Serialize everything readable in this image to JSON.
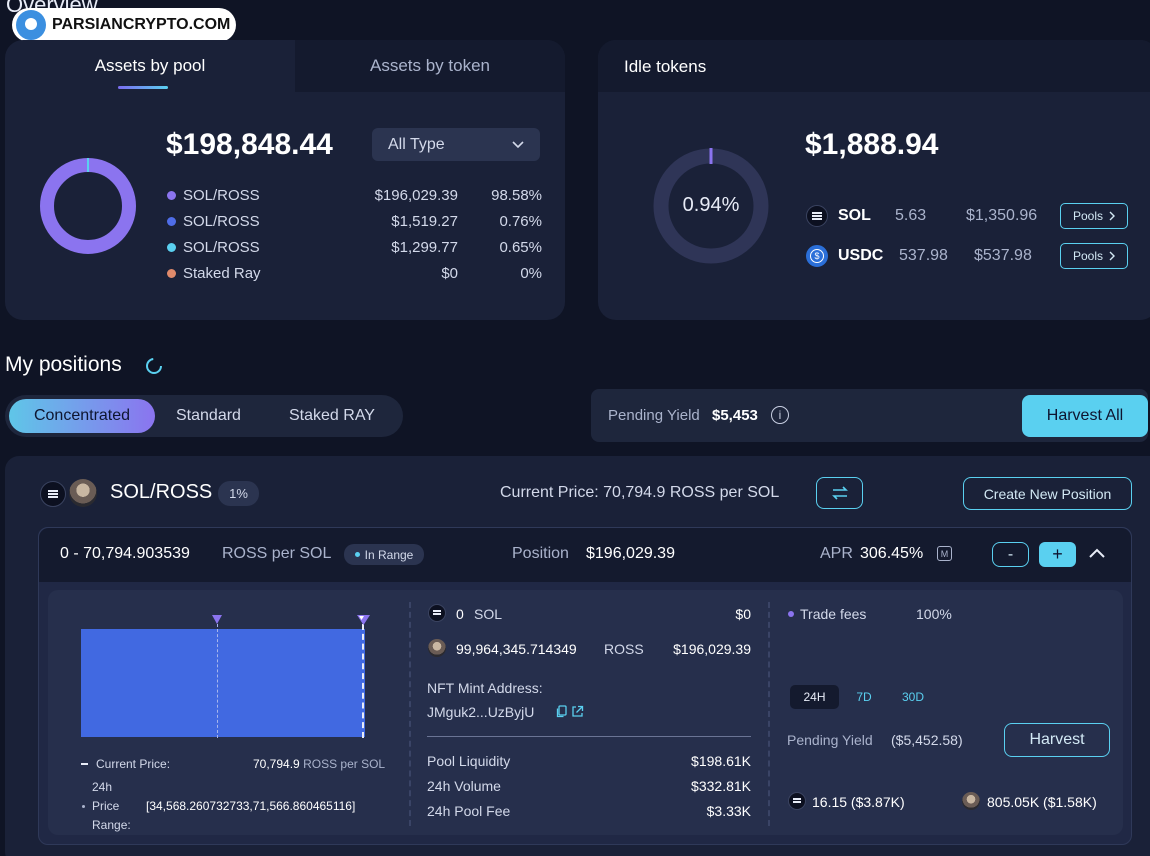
{
  "watermark": "PARSIANCRYPTO.COM",
  "overview_title": "Overview",
  "assets": {
    "tabs": [
      {
        "label": "Assets by pool"
      },
      {
        "label": "Assets by token"
      }
    ],
    "total": "$198,848.44",
    "filter": "All Type",
    "rows": [
      {
        "name": "SOL/ROSS",
        "value": "$196,029.39",
        "pct": "98.58%",
        "color": "#8b74ef"
      },
      {
        "name": "SOL/ROSS",
        "value": "$1,519.27",
        "pct": "0.76%",
        "color": "#4f6de8"
      },
      {
        "name": "SOL/ROSS",
        "value": "$1,299.77",
        "pct": "0.65%",
        "color": "#5ad0f0"
      },
      {
        "name": "Staked Ray",
        "value": "$0",
        "pct": "0%",
        "color": "#e08a6b"
      }
    ]
  },
  "idle": {
    "title": "Idle tokens",
    "total": "$1,888.94",
    "pct": "0.94%",
    "tokens": [
      {
        "symbol": "SOL",
        "amount": "5.63",
        "value": "$1,350.96",
        "btn": "Pools"
      },
      {
        "symbol": "USDC",
        "amount": "537.98",
        "value": "$537.98",
        "btn": "Pools"
      }
    ]
  },
  "positions": {
    "title": "My positions",
    "tabs": [
      "Concentrated",
      "Standard",
      "Staked RAY"
    ],
    "pending_label": "Pending Yield",
    "pending_value": "$5,453",
    "harvest_all": "Harvest All"
  },
  "pool": {
    "pair": "SOL/ROSS",
    "fee": "1%",
    "current_price": "Current Price: 70,794.9 ROSS per SOL",
    "create": "Create New Position",
    "range": "0 - 70,794.903539",
    "range_unit": "ROSS per SOL",
    "in_range": "In Range",
    "position_label": "Position",
    "position_value": "$196,029.39",
    "apr_label": "APR",
    "apr_value": "306.45%",
    "apr_badge": "M",
    "minus": "-",
    "plus": "+",
    "chart": {
      "current_price_label": "Current Price:",
      "current_price_value": "70,794.9",
      "current_price_unit": "ROSS per SOL",
      "range_label_1": "24h",
      "range_label_2": "Price",
      "range_label_3": "Range:",
      "range_value": "[34,568.260732733,71,566.860465116]"
    },
    "holdings": [
      {
        "amount": "0",
        "symbol": "SOL",
        "value": "$0"
      },
      {
        "amount": "99,964,345.714349",
        "symbol": "ROSS",
        "value": "$196,029.39"
      }
    ],
    "nft_label": "NFT Mint Address:",
    "nft_value": "JMguk2...UzByjU",
    "stats": [
      {
        "label": "Pool Liquidity",
        "value": "$198.61K"
      },
      {
        "label": "24h Volume",
        "value": "$332.81K"
      },
      {
        "label": "24h Pool Fee",
        "value": "$3.33K"
      }
    ],
    "trade_fees_label": "Trade fees",
    "trade_fees_value": "100%",
    "periods": [
      "24H",
      "7D",
      "30D"
    ],
    "pending_label": "Pending Yield",
    "pending_value": "($5,452.58)",
    "harvest": "Harvest",
    "rewards": [
      {
        "text": "16.15 ($3.87K)"
      },
      {
        "text": "805.05K ($1.58K)"
      }
    ]
  }
}
